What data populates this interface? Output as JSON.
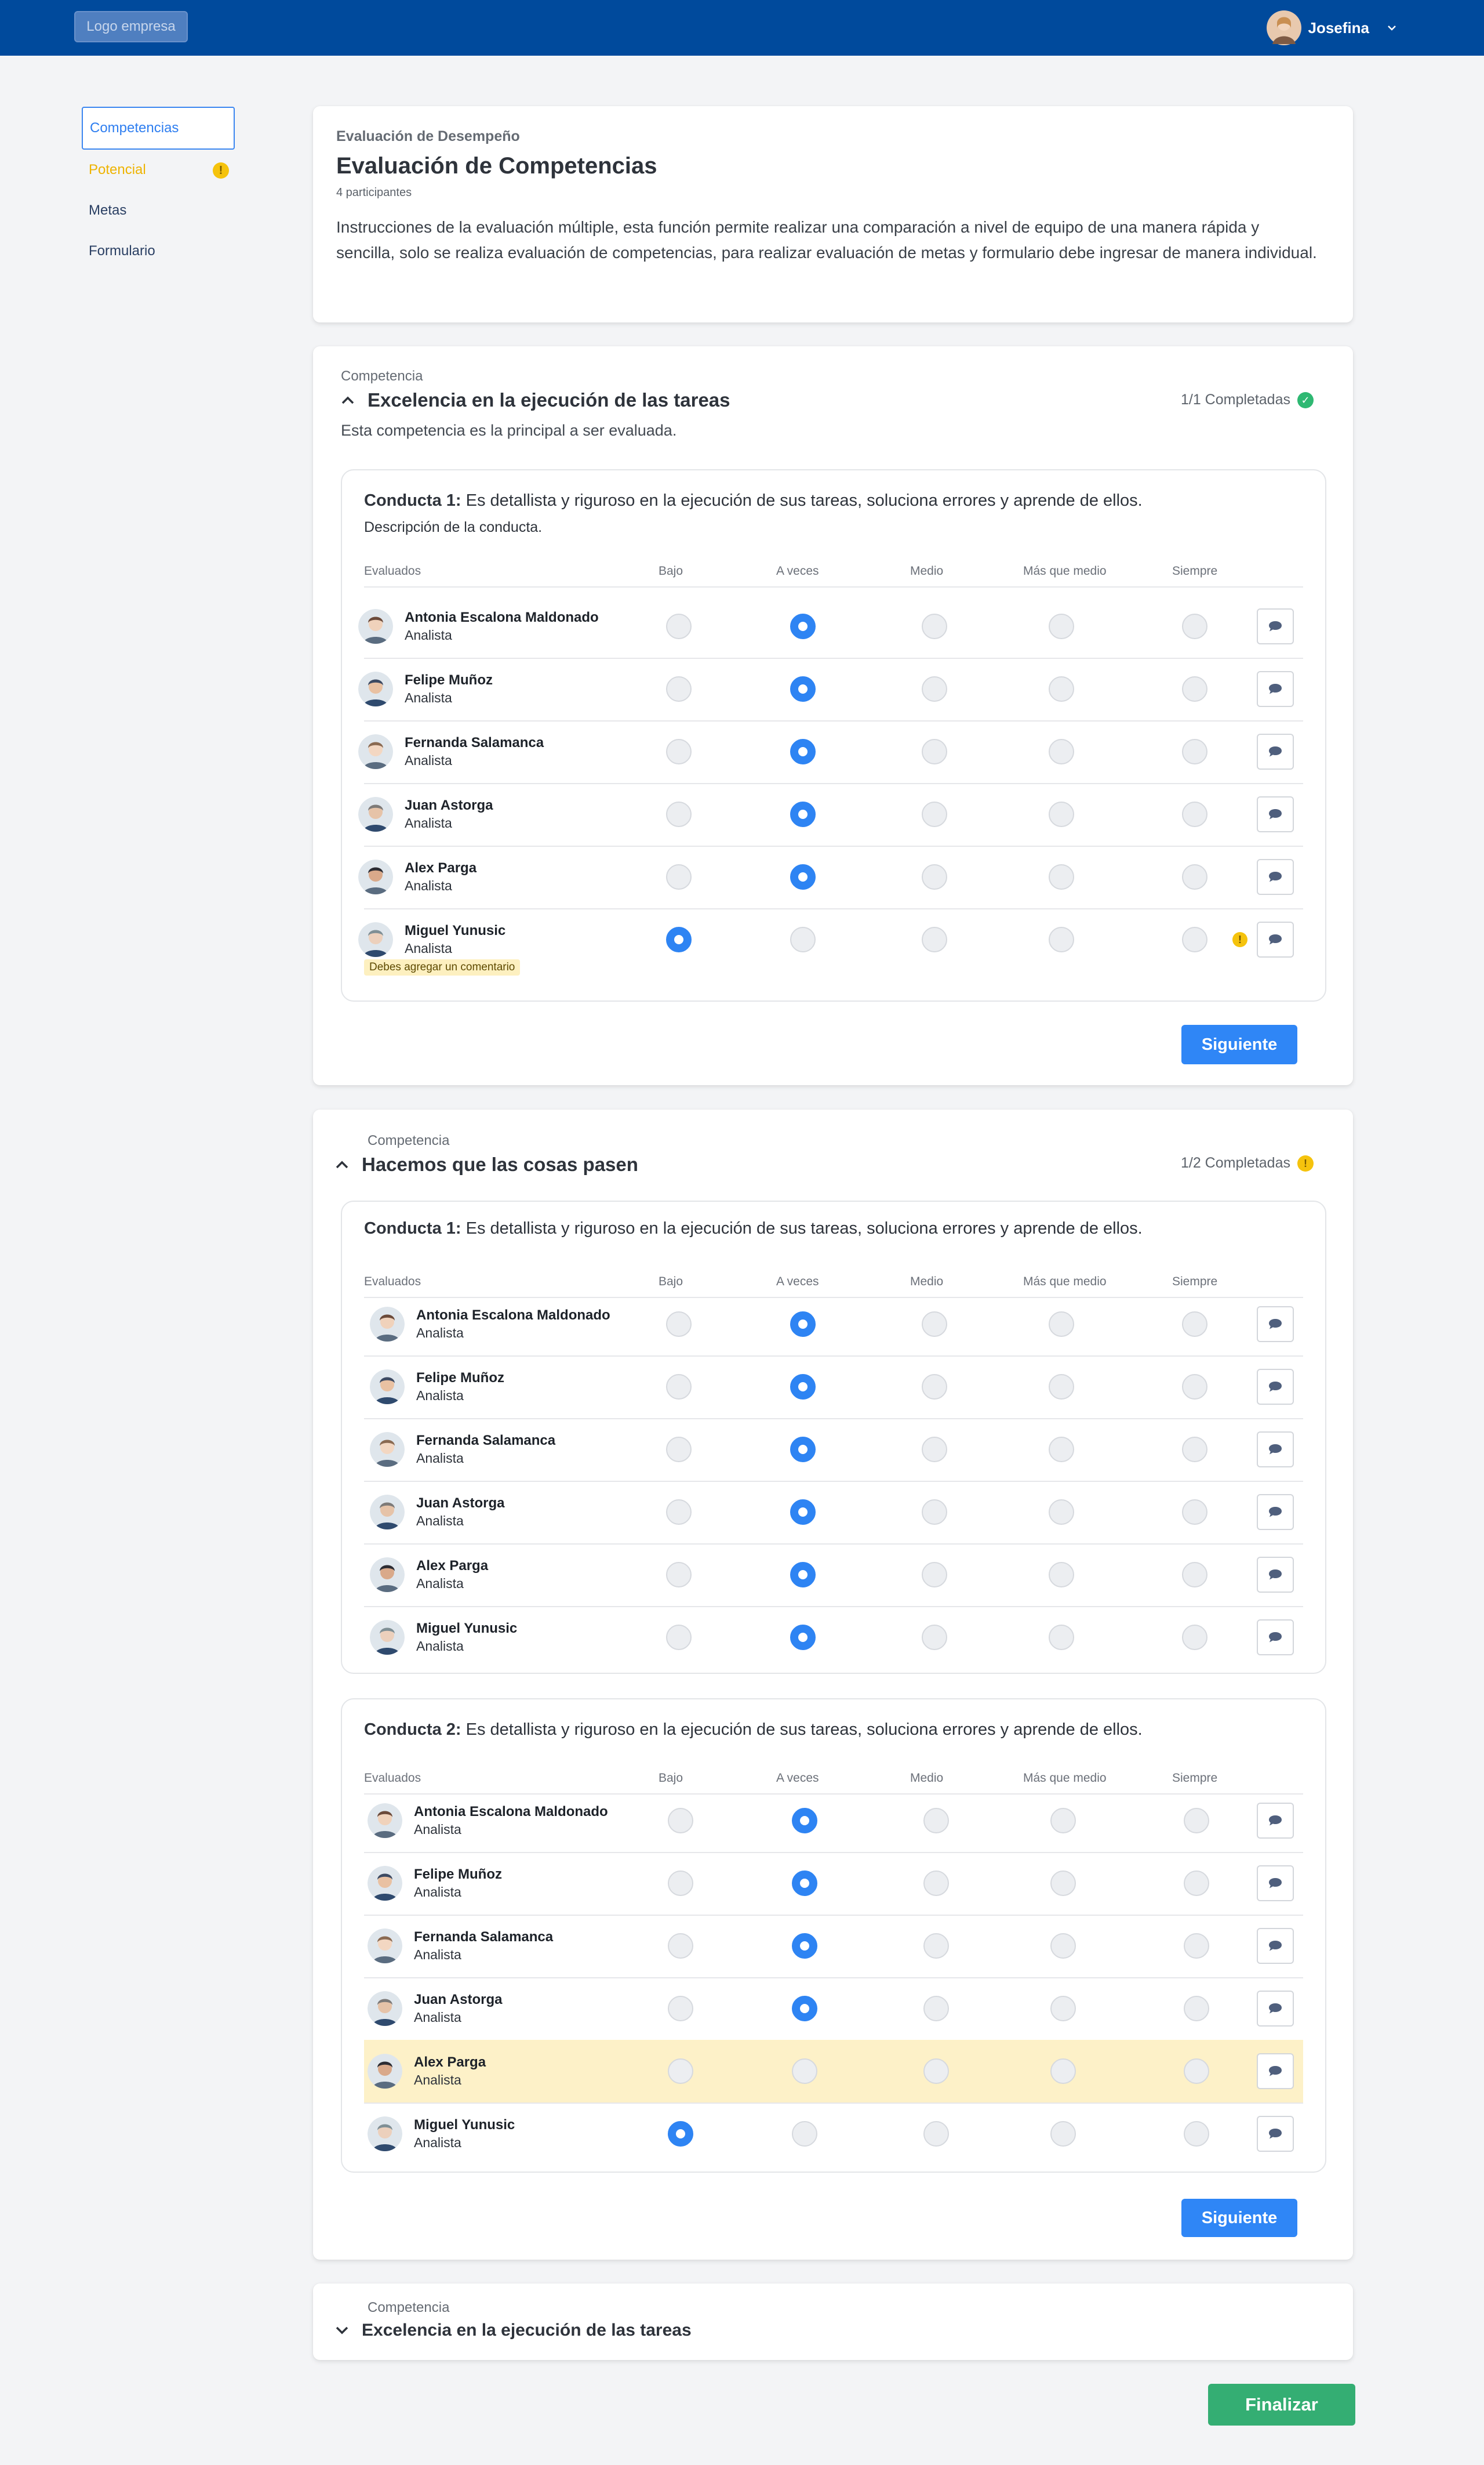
{
  "header": {
    "logo": "Logo empresa",
    "user_name": "Josefina",
    "menu_icon": "chevron-down-icon"
  },
  "sidebar": {
    "items": [
      {
        "label": "Competencias",
        "state": "active"
      },
      {
        "label": "Potencial",
        "state": "warning",
        "badge": "!"
      },
      {
        "label": "Metas",
        "state": "default"
      },
      {
        "label": "Formulario",
        "state": "default"
      }
    ]
  },
  "intro": {
    "overline": "Evaluación de Desempeño",
    "title": "Evaluación de Competencias",
    "participants": "4 participantes",
    "instructions": "Instrucciones de la evaluación múltiple, esta función permite realizar una comparación a nivel de equipo de una manera rápida y sencilla, solo se realiza evaluación de competencias, para realizar evaluación de metas y formulario debe ingresar de manera individual."
  },
  "columns": {
    "evaluated": "Evaluados",
    "options": [
      "Bajo",
      "A veces",
      "Medio",
      "Más que medio",
      "Siempre"
    ]
  },
  "competencies": [
    {
      "label": "Competencia",
      "title": "Excelencia en la ejecución de las tareas",
      "description": "Esta competencia es la principal a ser evaluada.",
      "progress": "1/1 Completadas",
      "status": "complete",
      "expanded": true,
      "next_label": "Siguiente",
      "behaviors": [
        {
          "label": "Conducta 1:",
          "text": "Es detallista y riguroso en la ejecución de sus tareas, soluciona errores y aprende de ellos.",
          "description": "Descripción de la conducta.",
          "rows": [
            {
              "name": "Antonia Escalona Maldonado",
              "role": "Analista",
              "selected": 1
            },
            {
              "name": "Felipe Muñoz",
              "role": "Analista",
              "selected": 1
            },
            {
              "name": "Fernanda Salamanca",
              "role": "Analista",
              "selected": 1
            },
            {
              "name": "Juan Astorga",
              "role": "Analista",
              "selected": 1
            },
            {
              "name": "Alex Parga",
              "role": "Analista",
              "selected": 1
            },
            {
              "name": "Miguel Yunusic",
              "role": "Analista",
              "selected": 0,
              "warning": "Debes agregar un comentario"
            }
          ]
        }
      ]
    },
    {
      "label": "Competencia",
      "title": "Hacemos que las cosas pasen",
      "progress": "1/2 Completadas",
      "status": "warning",
      "expanded": true,
      "next_label": "Siguiente",
      "behaviors": [
        {
          "label": "Conducta 1:",
          "text": "Es detallista y riguroso en la ejecución de sus tareas, soluciona errores y aprende de ellos.",
          "rows": [
            {
              "name": "Antonia Escalona Maldonado",
              "role": "Analista",
              "selected": 1
            },
            {
              "name": "Felipe Muñoz",
              "role": "Analista",
              "selected": 1
            },
            {
              "name": "Fernanda Salamanca",
              "role": "Analista",
              "selected": 1
            },
            {
              "name": "Juan Astorga",
              "role": "Analista",
              "selected": 1
            },
            {
              "name": "Alex Parga",
              "role": "Analista",
              "selected": 1
            },
            {
              "name": "Miguel Yunusic",
              "role": "Analista",
              "selected": 1
            }
          ]
        },
        {
          "label": "Conducta 2:",
          "text": "Es detallista y riguroso en la ejecución de sus tareas, soluciona errores y aprende de ellos.",
          "rows": [
            {
              "name": "Antonia Escalona Maldonado",
              "role": "Analista",
              "selected": 1
            },
            {
              "name": "Felipe Muñoz",
              "role": "Analista",
              "selected": 1
            },
            {
              "name": "Fernanda Salamanca",
              "role": "Analista",
              "selected": 1
            },
            {
              "name": "Juan Astorga",
              "role": "Analista",
              "selected": 1
            },
            {
              "name": "Alex Parga",
              "role": "Analista",
              "selected": null,
              "highlighted": true
            },
            {
              "name": "Miguel Yunusic",
              "role": "Analista",
              "selected": 0
            }
          ]
        }
      ]
    },
    {
      "label": "Competencia",
      "title": "Excelencia en la ejecución de las tareas",
      "expanded": false
    }
  ],
  "finalize_label": "Finalizar",
  "avatars": [
    "#6b4a3a",
    "#3d4a62",
    "#8a6a52",
    "#7d7a78",
    "#2c2c33",
    "#7f8f95"
  ],
  "colors": {
    "topbar": "#004a9c",
    "primary": "#2f86f6",
    "success": "#34ae73",
    "warning": "#f5c30d",
    "highlight_row": "#fdf1c8"
  }
}
